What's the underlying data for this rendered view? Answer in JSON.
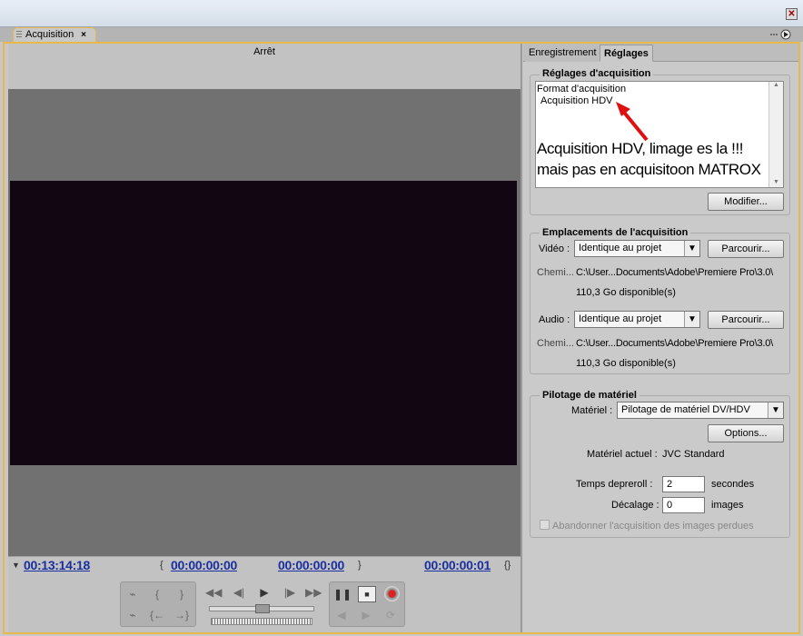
{
  "window": {
    "close_glyph": "✕"
  },
  "tab": {
    "label": "Acquisition",
    "close": "×"
  },
  "monitor": {
    "status": "Arrêt",
    "video_color": "#110612"
  },
  "timecodes": {
    "current": "00:13:14:18",
    "in_point": "00:00:00:00",
    "out_point": "00:00:00:00",
    "duration": "00:00:00:01"
  },
  "right_tabs": {
    "recording": "Enregistrement",
    "settings": "Réglages"
  },
  "capture_settings": {
    "title": "Réglages d'acquisition",
    "format_label": "Format d'acquisition",
    "format_value": "Acquisition HDV",
    "annotation_line1": "Acquisition HDV, limage es la !!!",
    "annotation_line2": "mais pas en acquisitoon MATROX",
    "modify_button": "Modifier..."
  },
  "capture_locations": {
    "title": "Emplacements de l'acquisition",
    "video_label": "Vidéo :",
    "video_select": "Identique au projet",
    "video_browse": "Parcourir...",
    "video_path_label": "Chemi...",
    "video_path": "C:\\User...Documents\\Adobe\\Premiere Pro\\3.0\\",
    "video_space": "110,3 Go disponible(s)",
    "audio_label": "Audio :",
    "audio_select": "Identique au projet",
    "audio_browse": "Parcourir...",
    "audio_path_label": "Chemi...",
    "audio_path": "C:\\User...Documents\\Adobe\\Premiere Pro\\3.0\\",
    "audio_space": "110,3 Go disponible(s)"
  },
  "device_control": {
    "title": "Pilotage de matériel",
    "device_label": "Matériel :",
    "device_select": "Pilotage de matériel DV/HDV",
    "options_button": "Options...",
    "current_device_label": "Matériel actuel :",
    "current_device": "JVC Standard",
    "preroll_label": "Temps depreroll :",
    "preroll_value": "2",
    "preroll_unit": "secondes",
    "offset_label": "Décalage :",
    "offset_value": "0",
    "offset_unit": "images",
    "abort_checkbox": "Abandonner l'acquisition des images perdues"
  }
}
